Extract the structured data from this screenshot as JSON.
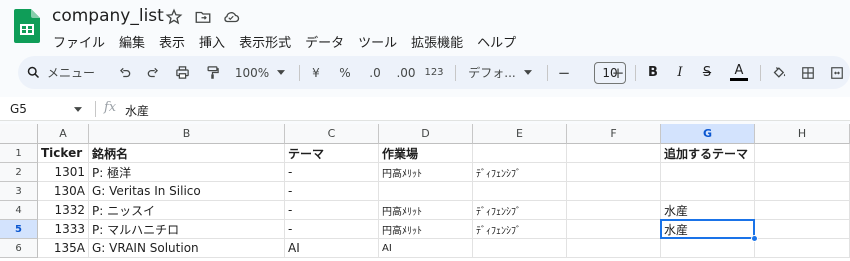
{
  "title": "company_list",
  "menu": [
    "ファイル",
    "編集",
    "表示",
    "挿入",
    "表示形式",
    "データ",
    "ツール",
    "拡張機能",
    "ヘルプ"
  ],
  "toolbar": {
    "search_label": "メニュー",
    "zoom": "100%",
    "currency": "¥",
    "percent": "%",
    "dec_decrease": ".0",
    "dec_increase": ".00",
    "number_format": "123",
    "font": "デフォ...",
    "font_size": "10",
    "minus": "−",
    "plus": "+",
    "bold": "B",
    "italic": "I",
    "strike": "S",
    "text_color": "A"
  },
  "formula_bar": {
    "cell_ref": "G5",
    "fx": "fx",
    "value": "水産"
  },
  "columns": [
    "A",
    "B",
    "C",
    "D",
    "E",
    "F",
    "G",
    "H"
  ],
  "rows": [
    "1",
    "2",
    "3",
    "4",
    "5",
    "6"
  ],
  "cells": [
    [
      "Ticker",
      "銘柄名",
      "テーマ",
      "作業場",
      "",
      "",
      "追加するテーマ",
      ""
    ],
    [
      "1301",
      "P: 極洋",
      "-",
      "円高ﾒﾘｯﾄ",
      "ﾃﾞｨﾌｪﾝｼﾌﾞ",
      "",
      "",
      ""
    ],
    [
      "130A",
      "G: Veritas In Silico",
      "-",
      "",
      "",
      "",
      "",
      ""
    ],
    [
      "1332",
      "P: ニッスイ",
      "-",
      "円高ﾒﾘｯﾄ",
      "ﾃﾞｨﾌｪﾝｼﾌﾞ",
      "",
      "水産",
      ""
    ],
    [
      "1333",
      "P: マルハニチロ",
      "-",
      "円高ﾒﾘｯﾄ",
      "ﾃﾞｨﾌｪﾝｼﾌﾞ",
      "",
      "水産",
      ""
    ],
    [
      "135A",
      "G: VRAIN Solution",
      "AI",
      "AI",
      "",
      "",
      "",
      ""
    ]
  ],
  "selected": {
    "col": "G",
    "row": "5"
  },
  "colors": {
    "accent": "#1a73e8",
    "selected_header": "#d3e3fd",
    "toolbar_bg": "#edf2fa",
    "logo_green": "#0f9d58"
  }
}
